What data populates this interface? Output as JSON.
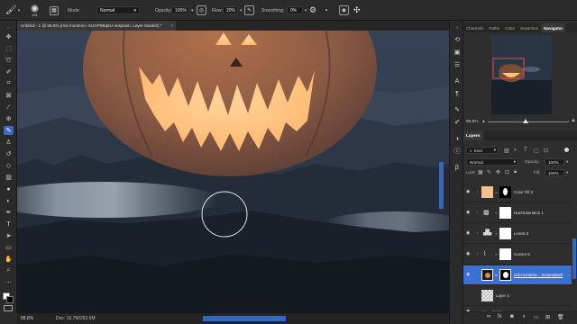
{
  "options_bar": {
    "brush_size": "161",
    "mode_label": "Mode:",
    "mode_value": "Normal",
    "opacity_label": "Opacity:",
    "opacity_value": "100%",
    "flow_label": "Flow:",
    "flow_value": "20%",
    "smoothing_label": "Smoothing:",
    "smoothing_value": "0%"
  },
  "document_tab": {
    "title": "Untitled - 1 @ 88.8% (rick-monteiro--XUGP9Bq9U-unsplash, Layer Mask/8) *",
    "close_glyph": "×"
  },
  "status_bar": {
    "zoom": "88.8%",
    "doc": "Doc: 16.7M/262.0M"
  },
  "panels": {
    "top_tabs": [
      "Channels",
      "Paths",
      "Color",
      "Swatches",
      "Navigator"
    ],
    "navigator_zoom": "88.8%",
    "layers_tab": "Layers",
    "kind_label": "Kind",
    "blend_mode": "Normal",
    "opacity_label": "Opacity:",
    "opacity_value": "100%",
    "lock_label": "Lock:",
    "fill_label": "Fill:",
    "fill_value": "100%"
  },
  "layers": [
    {
      "name": "Color Fill 3",
      "type": "fill",
      "selected": false
    },
    {
      "name": "Hue/Saturation 1",
      "type": "adjustment",
      "icon": "hue-icon",
      "selected": false
    },
    {
      "name": "Levels 3",
      "type": "adjustment",
      "icon": "levels-icon",
      "selected": false
    },
    {
      "name": "Curves 5",
      "type": "adjustment",
      "icon": "curves-icon",
      "selected": false
    },
    {
      "name": "rick-monteiro-...XUunsplash",
      "type": "image",
      "selected": true
    },
    {
      "name": "Layer 3",
      "type": "image",
      "selected": false
    },
    {
      "name": "tower",
      "type": "group",
      "selected": false
    }
  ],
  "colors": {
    "accent": "#3a6fd3",
    "fill_swatch": "#f6c18c",
    "pumpkin_glow": "#ffc37a"
  }
}
